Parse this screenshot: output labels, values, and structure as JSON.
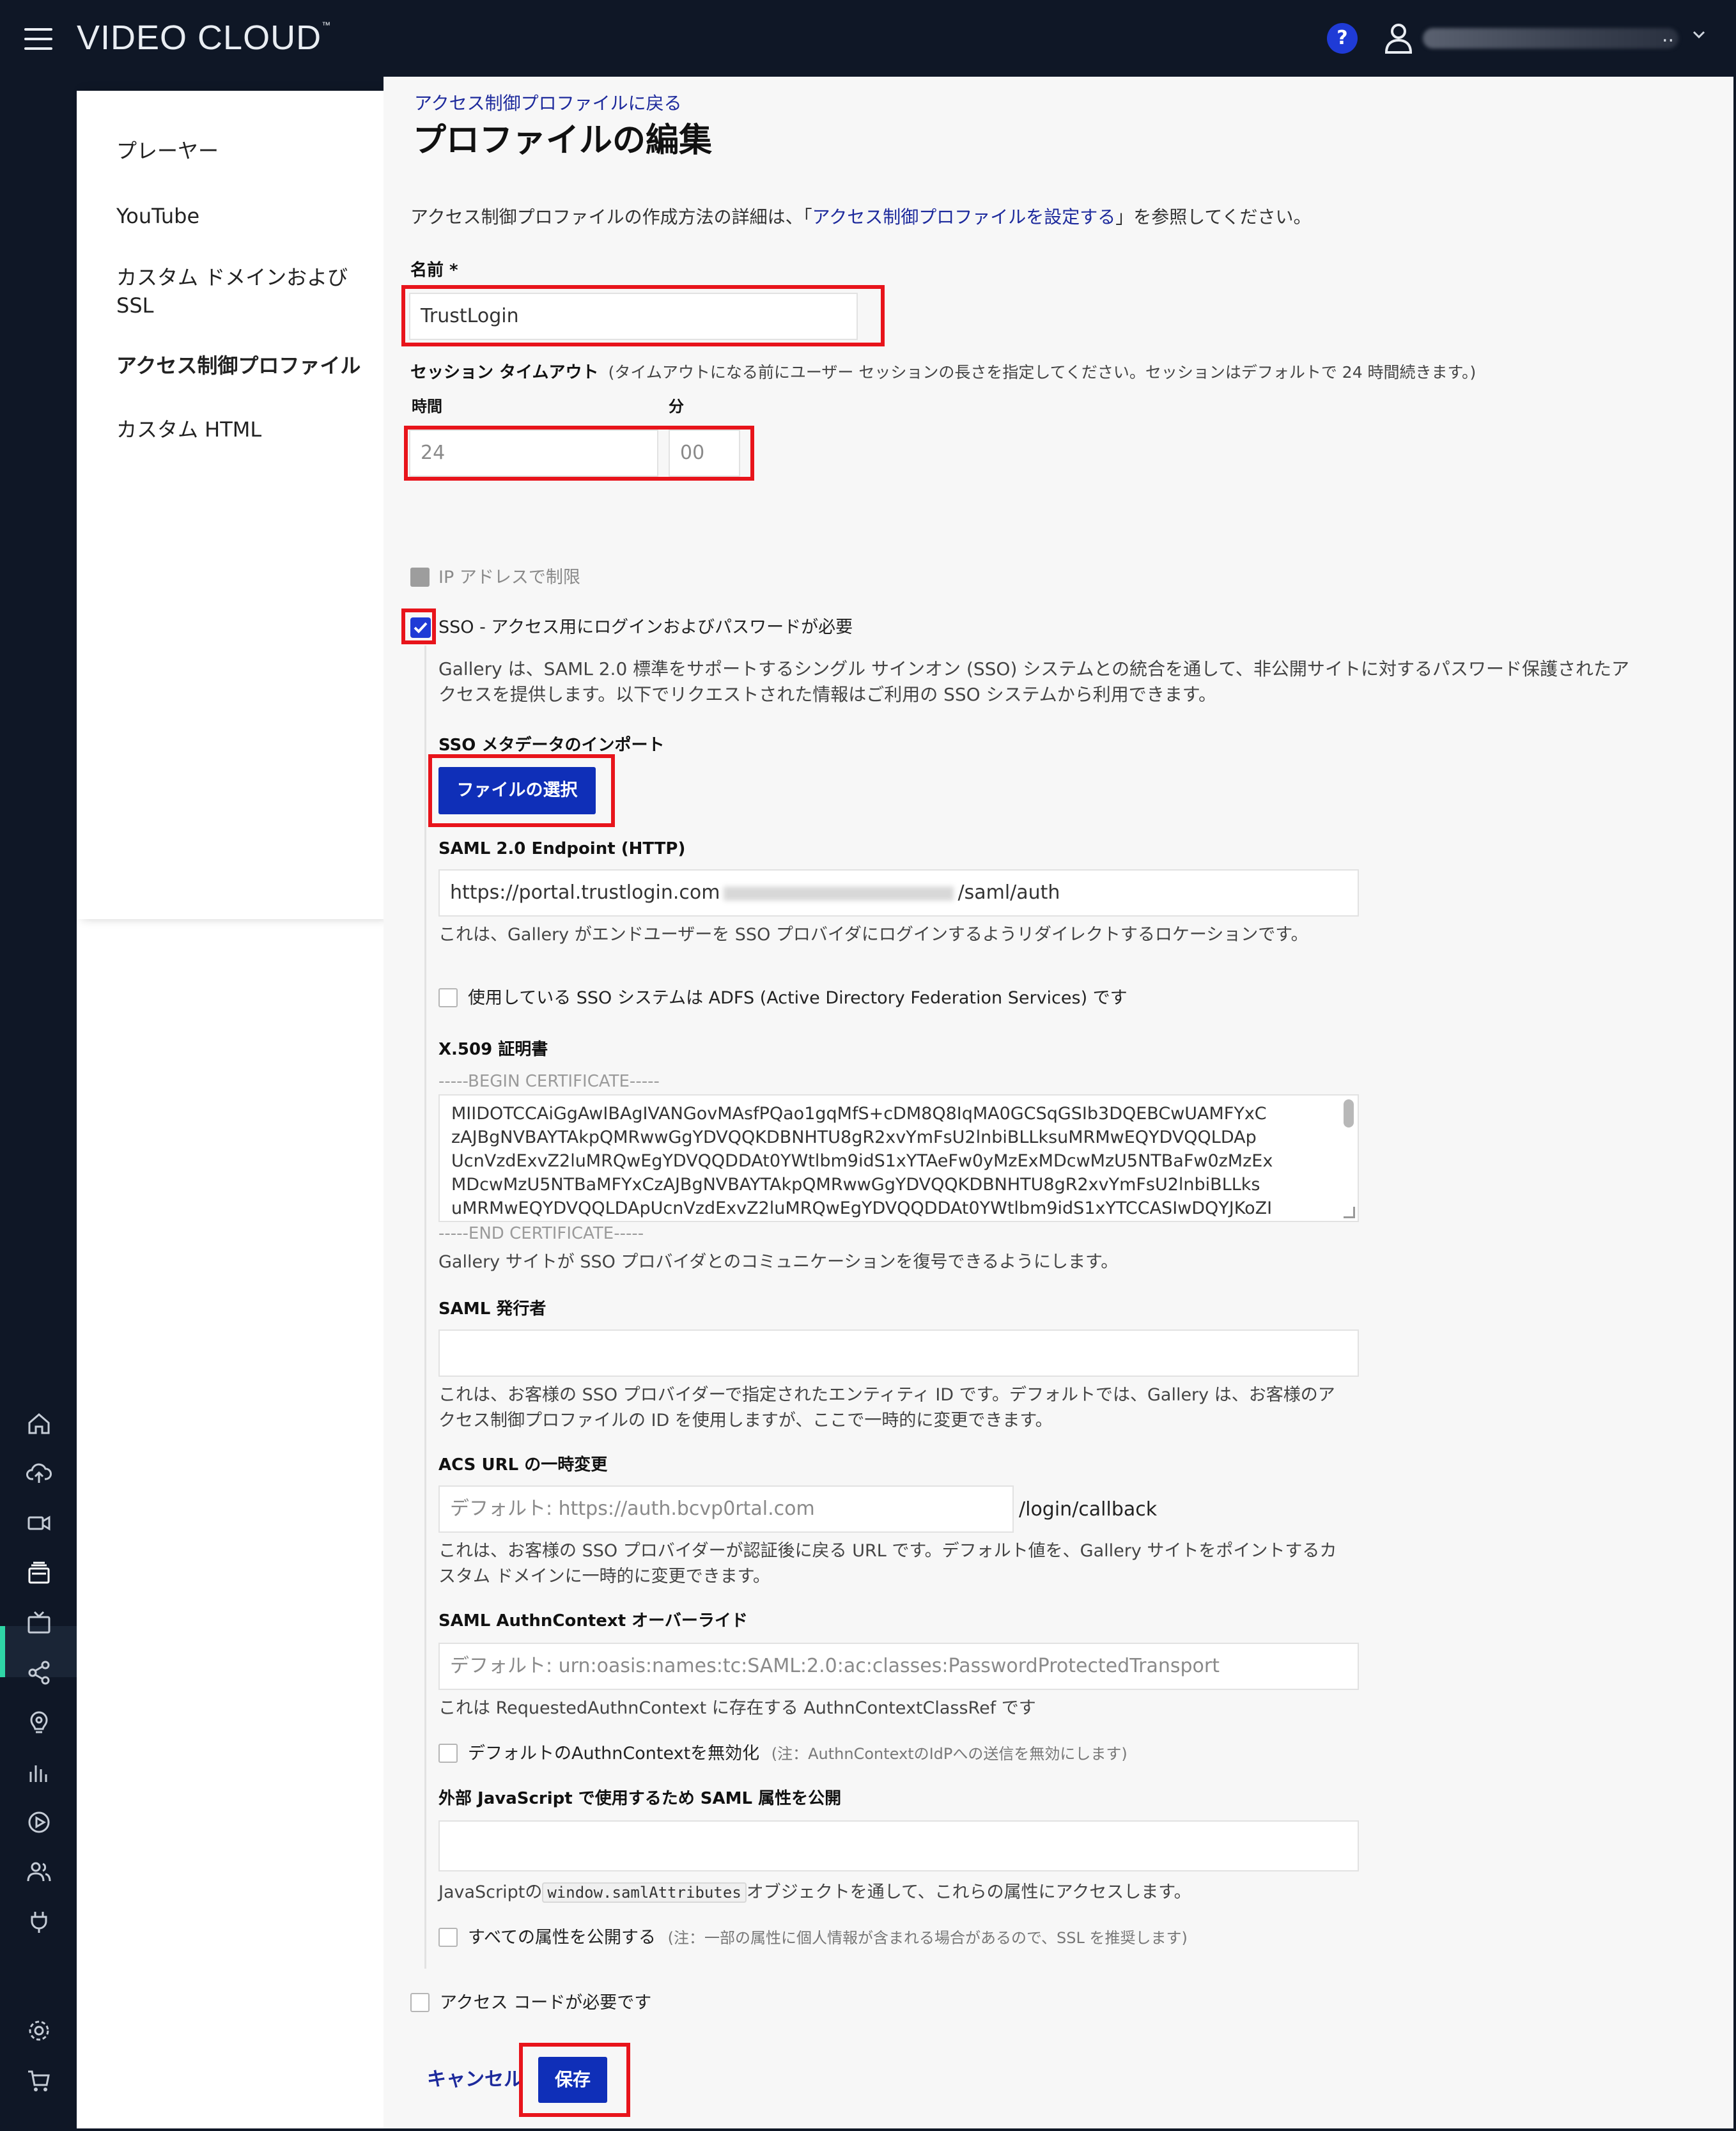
{
  "topbar": {
    "brand": "VIDEO CLOUD",
    "brand_tm": "™",
    "help_label": "?",
    "user_dots": ".."
  },
  "sidebar": {
    "items": [
      {
        "label": "プレーヤー",
        "active": false
      },
      {
        "label": "YouTube",
        "active": false
      },
      {
        "label": "カスタム ドメインおよび",
        "active": false
      },
      {
        "label": "SSL",
        "active": false
      },
      {
        "label": "アクセス制御プロファイル",
        "active": true
      },
      {
        "label": "カスタム HTML",
        "active": false
      }
    ]
  },
  "header": {
    "back_link": "アクセス制御プロファイルに戻る",
    "title": "プロファイルの編集"
  },
  "intro": {
    "prefix": "アクセス制御プロファイルの作成方法の詳細は、「",
    "link": "アクセス制御プロファイルを設定する",
    "suffix": "」を参照してください。"
  },
  "name_field": {
    "label": "名前 *",
    "value": "TrustLogin"
  },
  "session": {
    "label": "セッション タイムアウト",
    "hint": "(タイムアウトになる前にユーザー セッションの長さを指定してください。セッションはデフォルトで 24 時間続きます。)",
    "hours_label": "時間",
    "minutes_label": "分",
    "hours_value": "24",
    "minutes_value": "00"
  },
  "ip_restrict": {
    "label": "IP アドレスで制限"
  },
  "sso": {
    "checkbox_label": "SSO - アクセス用にログインおよびパスワードが必要",
    "description_1": "Gallery は、SAML 2.0 標準をサポートするシングル サインオン (SSO) システムとの統合を通して、非公開サイトに対するパスワード保護されたア",
    "description_2": "クセスを提供します。以下でリクエストされた情報はご利用の SSO システムから利用できます。",
    "metadata_label": "SSO メタデータのインポート",
    "choose_file_button": "ファイルの選択",
    "endpoint_label": "SAML 2.0 Endpoint (HTTP)",
    "endpoint_prefix": "https://portal.trustlogin.com",
    "endpoint_suffix": "/saml/auth",
    "endpoint_hint": "これは、Gallery がエンドユーザーを SSO プロバイダにログインするようリダイレクトするロケーションです。",
    "adfs_label": "使用している SSO システムは ADFS (Active Directory Federation Services) です",
    "cert_label": "X.509 証明書",
    "cert_begin": "-----BEGIN CERTIFICATE-----",
    "cert_lines": [
      "MIIDOTCCAiGgAwIBAgIVANGovMAsfPQao1gqMfS+cDM8Q8IqMA0GCSqGSIb3DQEBCwUAMFYxC",
      "zAJBgNVBAYTAkpQMRwwGgYDVQQKDBNHTU8gR2xvYmFsU2lnbiBLLksuMRMwEQYDVQQLDAp",
      "UcnVzdExvZ2luMRQwEgYDVQQDDAt0YWtlbm9idS1xYTAeFw0yMzExMDcwMzU5NTBaFw0zMzEx",
      "MDcwMzU5NTBaMFYxCzAJBgNVBAYTAkpQMRwwGgYDVQQKDBNHTU8gR2xvYmFsU2lnbiBLLks",
      "uMRMwEQYDVQQLDApUcnVzdExvZ2luMRQwEgYDVQQDDAt0YWtlbm9idS1xYTCCASIwDQYJKoZI"
    ],
    "cert_end": "-----END CERTIFICATE-----",
    "cert_hint": "Gallery サイトが SSO プロバイダとのコミュニケーションを復号できるようにします。",
    "issuer_label": "SAML 発行者",
    "issuer_value": "",
    "issuer_hint_1": "これは、お客様の SSO プロバイダーで指定されたエンティティ ID です。デフォルトでは、Gallery は、お客様のア",
    "issuer_hint_2": "クセス制御プロファイルの ID を使用しますが、ここで一時的に変更できます。",
    "acs_label": "ACS URL の一時変更",
    "acs_placeholder": "デフォルト: https://auth.bcvp0rtal.com",
    "acs_suffix": "/login/callback",
    "acs_hint_1": "これは、お客様の SSO プロバイダーが認証後に戻る URL です。デフォルト値を、Gallery サイトをポイントするカ",
    "acs_hint_2": "スタム ドメインに一時的に変更できます。",
    "authn_label": "SAML AuthnContext オーバーライド",
    "authn_placeholder": "デフォルト: urn:oasis:names:tc:SAML:2.0:ac:classes:PasswordProtectedTransport",
    "authn_hint": "これは RequestedAuthnContext に存在する AuthnContextClassRef です",
    "disable_authn_label": "デフォルトのAuthnContextを無効化",
    "disable_authn_note": "(注：AuthnContextのIdPへの送信を無効にします)",
    "expose_label": "外部 JavaScript で使用するため SAML 属性を公開",
    "expose_value": "",
    "expose_hint_prefix": "JavaScriptの",
    "expose_hint_code": "window.samlAttributes",
    "expose_hint_suffix": "オブジェクトを通して、これらの属性にアクセスします。",
    "expose_all_label": "すべての属性を公開する",
    "expose_all_note": "(注：一部の属性に個人情報が含まれる場合があるので、SSL を推奨します)"
  },
  "access_code": {
    "label": "アクセス コードが必要です"
  },
  "actions": {
    "cancel": "キャンセル",
    "save": "保存"
  }
}
